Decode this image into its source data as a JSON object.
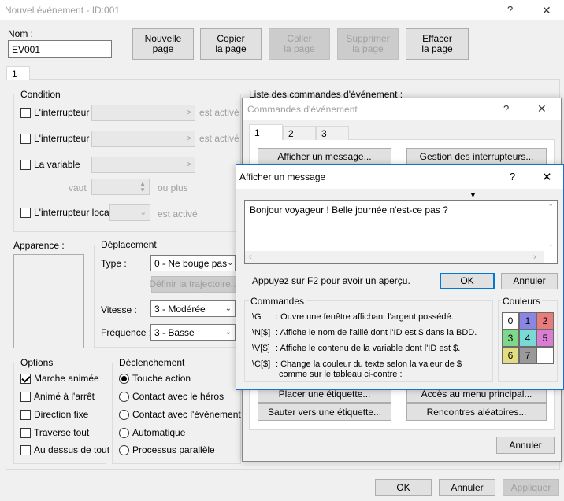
{
  "main_window": {
    "title": "Nouvel événement - ID:001",
    "name_label": "Nom :",
    "name_value": "EV001",
    "page_buttons": {
      "new_page": "Nouvelle\npage",
      "copy_page": "Copier\nla page",
      "paste_page": "Coller\nla page",
      "delete_page": "Supprimer\nla page",
      "clear_page": "Effacer\nla page"
    },
    "page_tab": "1",
    "condition": {
      "title": "Condition",
      "switch1": "L'interrupteur",
      "switch2": "L'interrupteur",
      "variable": "La variable",
      "value_label": "vaut",
      "or_more": "ou plus",
      "local_switch": "L'interrupteur local",
      "active1": "est activé",
      "active2": "est activé",
      "active3": "est activé"
    },
    "appearance_label": "Apparence :",
    "movement": {
      "title": "Déplacement",
      "type_label": "Type :",
      "type_value": "0 - Ne bouge pas",
      "route_button": "Définir la trajectoire...",
      "speed_label": "Vitesse :",
      "speed_value": "3 - Modérée",
      "freq_label": "Fréquence :",
      "freq_value": "3 - Basse"
    },
    "options": {
      "title": "Options",
      "walking": "Marche animée",
      "stepping": "Animé à l'arrêt",
      "dir_fix": "Direction fixe",
      "through": "Traverse tout",
      "on_top": "Au dessus de tout"
    },
    "trigger": {
      "title": "Déclenchement",
      "action": "Touche action",
      "player_touch": "Contact avec le héros",
      "event_touch": "Contact avec l'événement",
      "autorun": "Automatique",
      "parallel": "Processus parallèle"
    },
    "commands_list_label": "Liste des commandes d'événement :",
    "ok": "OK",
    "cancel": "Annuler",
    "apply": "Appliquer",
    "help": "?",
    "close": "✕"
  },
  "commands_window": {
    "title": "Commandes d'événement",
    "tabs": [
      "1",
      "2",
      "3"
    ],
    "show_message": "Afficher un message...",
    "switches": "Gestion des interrupteurs...",
    "place_label": "Placer une étiquette...",
    "main_menu": "Accès au menu principal...",
    "jump_label": "Sauter vers une étiquette...",
    "encounters": "Rencontres aléatoires...",
    "cancel": "Annuler",
    "help": "?",
    "close": "✕"
  },
  "message_window": {
    "title": "Afficher un message",
    "text": "Bonjour voyageur ! Belle journée n'est-ce pas ?",
    "preview_hint": "Appuyez sur F2 pour avoir un aperçu.",
    "ok": "OK",
    "cancel": "Annuler",
    "commands_title": "Commandes",
    "colors_title": "Couleurs",
    "cmd_g_code": "\\G",
    "cmd_g": ": Ouvre une fenêtre affichant l'argent possédé.",
    "cmd_n_code": "\\N[$]",
    "cmd_n": ": Affiche le nom de l'allié dont l'ID est $ dans la BDD.",
    "cmd_v_code": "\\V[$]",
    "cmd_v": ": Affiche le contenu de la variable dont l'ID est $.",
    "cmd_c_code": "\\C[$]",
    "cmd_c1": ": Change la couleur du texte selon la valeur de $",
    "cmd_c2": "comme sur le tableau ci-contre :",
    "help": "?",
    "close": "✕",
    "swatches": [
      {
        "n": "0",
        "color": "#ffffff"
      },
      {
        "n": "1",
        "color": "#8a86e6"
      },
      {
        "n": "2",
        "color": "#e87c7c"
      },
      {
        "n": "3",
        "color": "#7fd88a"
      },
      {
        "n": "4",
        "color": "#7ad9d6"
      },
      {
        "n": "5",
        "color": "#d87fd4"
      },
      {
        "n": "6",
        "color": "#e2dc82"
      },
      {
        "n": "7",
        "color": "#9a9a9a"
      },
      {
        "n": "",
        "color": "#ffffff"
      }
    ]
  }
}
